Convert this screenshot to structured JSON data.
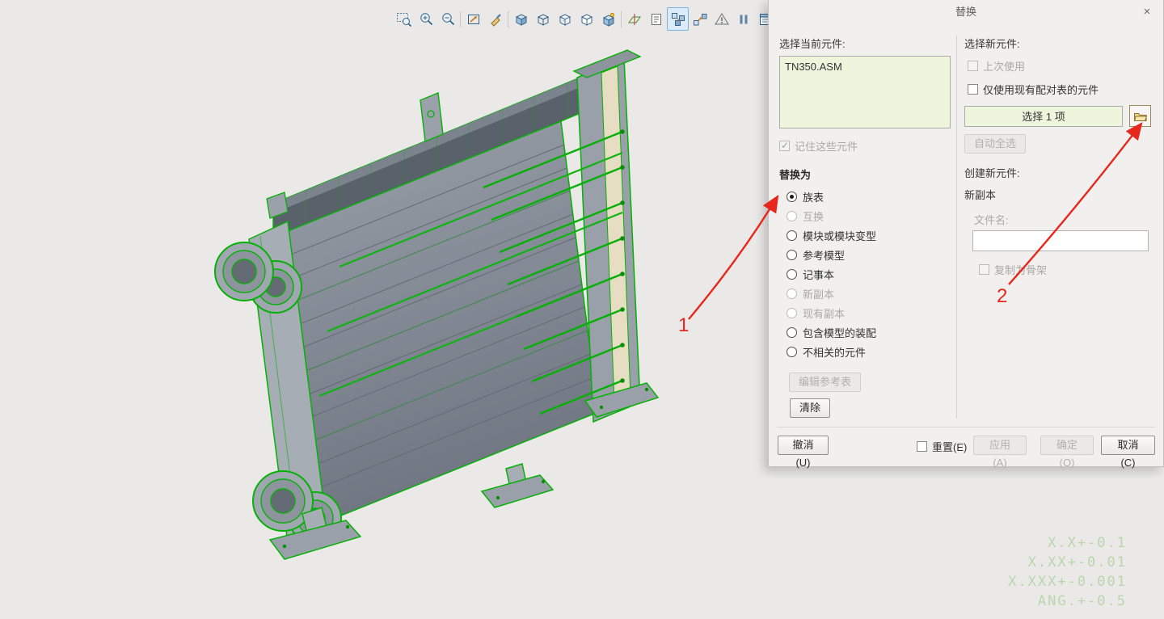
{
  "window": {
    "title": "替换",
    "close_icon": "×"
  },
  "toolbar": {
    "icons": [
      "zoom-region",
      "zoom-in",
      "zoom-out",
      "refit",
      "repaint",
      "shaded-cube",
      "wireframe-cube",
      "hidden-line-cube",
      "no-hidden-cube",
      "enhanced-realism",
      "datum-display",
      "annotation-display",
      "exploded-view",
      "component-assemble",
      "assembly-warning",
      "pause",
      "view-manager"
    ],
    "selected_index": 12
  },
  "viewport": {
    "model_edge_color": "#07b007"
  },
  "dialog": {
    "left": {
      "current_component_label": "选择当前元件:",
      "current_component_value": "TN350.ASM",
      "remember_checkbox_label": "记住这些元件",
      "remember_checked": true,
      "replace_with_heading": "替换为",
      "options": [
        {
          "label": "族表",
          "selected": true,
          "enabled": true
        },
        {
          "label": "互换",
          "selected": false,
          "enabled": false
        },
        {
          "label": "模块或模块变型",
          "selected": false,
          "enabled": true
        },
        {
          "label": "参考模型",
          "selected": false,
          "enabled": true
        },
        {
          "label": "记事本",
          "selected": false,
          "enabled": true
        },
        {
          "label": "新副本",
          "selected": false,
          "enabled": false
        },
        {
          "label": "现有副本",
          "selected": false,
          "enabled": false
        },
        {
          "label": "包含模型的装配",
          "selected": false,
          "enabled": true
        },
        {
          "label": "不相关的元件",
          "selected": false,
          "enabled": true
        }
      ],
      "edit_reference_table_button": "编辑参考表",
      "clear_button": "清除"
    },
    "right": {
      "new_component_label": "选择新元件:",
      "last_used_label": "上次使用",
      "last_used_checked": false,
      "pairing_table_label": "仅使用现有配对表的元件",
      "pairing_table_checked": false,
      "selection_value": "选择 1 项",
      "auto_select_button": "自动全选",
      "create_new_label": "创建新元件:",
      "new_copy_label": "新副本",
      "file_name_label": "文件名:",
      "file_name_value": "",
      "copy_as_skeleton_label": "复制为骨架",
      "copy_as_skeleton_checked": false
    },
    "footer": {
      "undo": "撤消(U)",
      "reset": "重置(E)",
      "reset_checked": false,
      "apply": "应用(A)",
      "ok": "确定(O)",
      "cancel": "取消(C)"
    }
  },
  "annotations": {
    "step1": "1",
    "step2": "2",
    "arrow_color": "#e8271c"
  },
  "tolerance_note": {
    "lines": [
      "X.X+-0.1",
      "X.XX+-0.01",
      "X.XXX+-0.001",
      "ANG.+-0.5"
    ],
    "color": "#b9d6ad"
  }
}
